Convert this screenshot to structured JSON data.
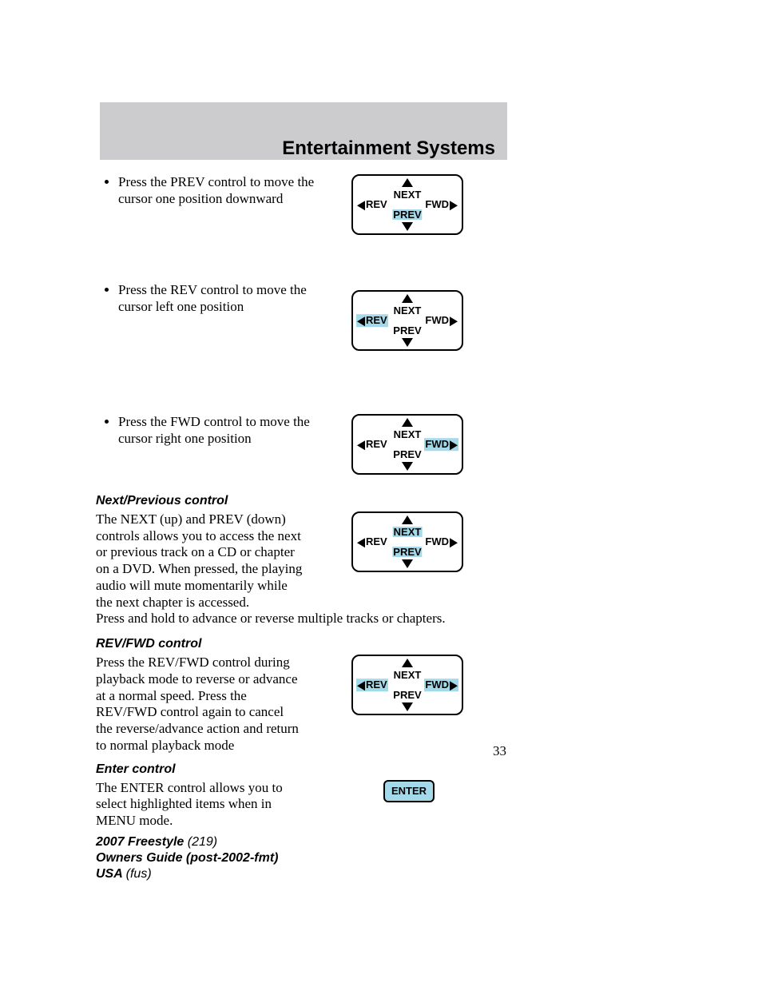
{
  "header": {
    "title": "Entertainment Systems"
  },
  "bullets": {
    "prev": "Press the PREV control to move the cursor one position downward",
    "rev": "Press the REV control to move the cursor left one position",
    "fwd": "Press the FWD control to move the cursor right one position"
  },
  "dpad": {
    "next": "NEXT",
    "prev": "PREV",
    "rev": "REV",
    "fwd": "FWD"
  },
  "sections": {
    "nextprev": {
      "heading": "Next/Previous control",
      "para1": "The NEXT (up) and PREV (down) controls allows you to access the next or previous track on a CD or chapter on a DVD. When pressed, the playing audio will mute momentarily while the next chapter is accessed.",
      "para2": "Press and hold to advance or reverse multiple tracks or chapters."
    },
    "revfwd": {
      "heading": "REV/FWD control",
      "para": "Press the REV/FWD control during playback mode to reverse or advance at a normal speed. Press the REV/FWD control again to cancel the reverse/advance action and return to normal playback mode"
    },
    "enter": {
      "heading": "Enter control",
      "para": "The ENTER control allows you to select highlighted items when in MENU mode.",
      "button": "ENTER"
    }
  },
  "page_number": "33",
  "footer": {
    "line1a": "2007 Freestyle ",
    "line1b": "(219)",
    "line2": "Owners Guide (post-2002-fmt)",
    "line3a": "USA ",
    "line3b": "(fus)"
  }
}
